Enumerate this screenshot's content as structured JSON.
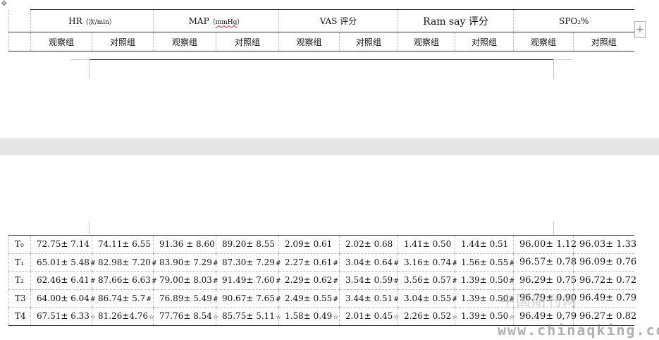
{
  "header": {
    "groups": [
      {
        "name": "HR",
        "unit": "（次/min）"
      },
      {
        "name": "MAP",
        "unit_prefix": "（",
        "unit_core": "mmHg",
        "unit_suffix": "）"
      },
      {
        "name": "VAS 评分"
      },
      {
        "name": "Ram say  评分"
      },
      {
        "name": "SPO₂%"
      }
    ],
    "subheaders": [
      "观察组",
      "对照组",
      "观察组",
      "对照组",
      "观察组",
      "对照组",
      "观察组",
      "对照组",
      "观察组",
      "对照组"
    ]
  },
  "rows": [
    {
      "label": "T₀",
      "cells": [
        {
          "v": "72.75± 7.14",
          "m": ""
        },
        {
          "v": "74.11± 6.55",
          "m": ""
        },
        {
          "v": "91.36 ± 8.60",
          "m": ""
        },
        {
          "v": "89.20± 8.55",
          "m": ""
        },
        {
          "v": "2.09± 0.61",
          "m": ""
        },
        {
          "v": "2.02± 0.68",
          "m": ""
        },
        {
          "v": "1.41± 0.50",
          "m": ""
        },
        {
          "v": "1.44± 0.51",
          "m": ""
        },
        {
          "v": "96.00± 1.12",
          "m": ""
        },
        {
          "v": "96.03± 1.33",
          "m": ""
        }
      ]
    },
    {
      "label": "T₁",
      "cells": [
        {
          "v": "65.01± 5.48",
          "m": "#"
        },
        {
          "v": "82.98± 7.20",
          "m": "#"
        },
        {
          "v": "83.90± 7.29",
          "m": "#"
        },
        {
          "v": "87.30± 7.29",
          "m": "#"
        },
        {
          "v": "2.27± 0.61",
          "m": "#"
        },
        {
          "v": "3.04± 0.64",
          "m": "#"
        },
        {
          "v": "3.16± 0.74",
          "m": "#"
        },
        {
          "v": "1.56± 0.55",
          "m": "#"
        },
        {
          "v": "96.57± 0.78",
          "m": ""
        },
        {
          "v": "96.09± 0.76",
          "m": ""
        }
      ]
    },
    {
      "label": "T₂",
      "cells": [
        {
          "v": "62.46± 6.41",
          "m": "#"
        },
        {
          "v": "87.66± 6.63",
          "m": "#"
        },
        {
          "v": "79.00± 8.03",
          "m": "#"
        },
        {
          "v": "91.49± 7.60",
          "m": "#"
        },
        {
          "v": "2.29± 0.62",
          "m": "#"
        },
        {
          "v": "3.54± 0.59",
          "m": "#"
        },
        {
          "v": "3.56± 0.57",
          "m": "#"
        },
        {
          "v": "1.39± 0.50",
          "m": "#"
        },
        {
          "v": "96.29± 0.75",
          "m": ""
        },
        {
          "v": "96.72± 0.72",
          "m": ""
        }
      ]
    },
    {
      "label": "T3",
      "cells": [
        {
          "v": "64.00± 6.04",
          "m": "#"
        },
        {
          "v": "86.74± 5.7",
          "m": "#"
        },
        {
          "v": "76.89± 5.49",
          "m": "#"
        },
        {
          "v": "90.67± 7.65",
          "m": "#"
        },
        {
          "v": "2.49± 0.55",
          "m": "#"
        },
        {
          "v": "3.44± 0.51",
          "m": "#"
        },
        {
          "v": "3.04± 0.55",
          "m": "#"
        },
        {
          "v": "1.39± 0.50",
          "m": "#"
        },
        {
          "v": "96.79± 0.90",
          "m": ""
        },
        {
          "v": "96.49± 0.79",
          "m": ""
        }
      ]
    },
    {
      "label": "T4",
      "cells": [
        {
          "v": "67.51± 6.33",
          "m": "☆"
        },
        {
          "v": "81.26±4.76",
          "m": "☆"
        },
        {
          "v": "77.76± 8.54",
          "m": "☆"
        },
        {
          "v": "85.75± 5.11",
          "m": "☆"
        },
        {
          "v": "1.58± 0.49",
          "m": "☆"
        },
        {
          "v": "2.01± 0.45",
          "m": "☆"
        },
        {
          "v": "2.26± 0.52",
          "m": "☆"
        },
        {
          "v": "1.39± 0.50",
          "m": "☆"
        },
        {
          "v": "96.49± 0,79",
          "m": ""
        },
        {
          "v": "96.27± 0.82",
          "m": ""
        }
      ]
    }
  ],
  "ui": {
    "add_column": "+",
    "move_handle": "✥"
  },
  "watermark": {
    "cn": "中国期刊网",
    "url": "www.chinaqking.com"
  }
}
